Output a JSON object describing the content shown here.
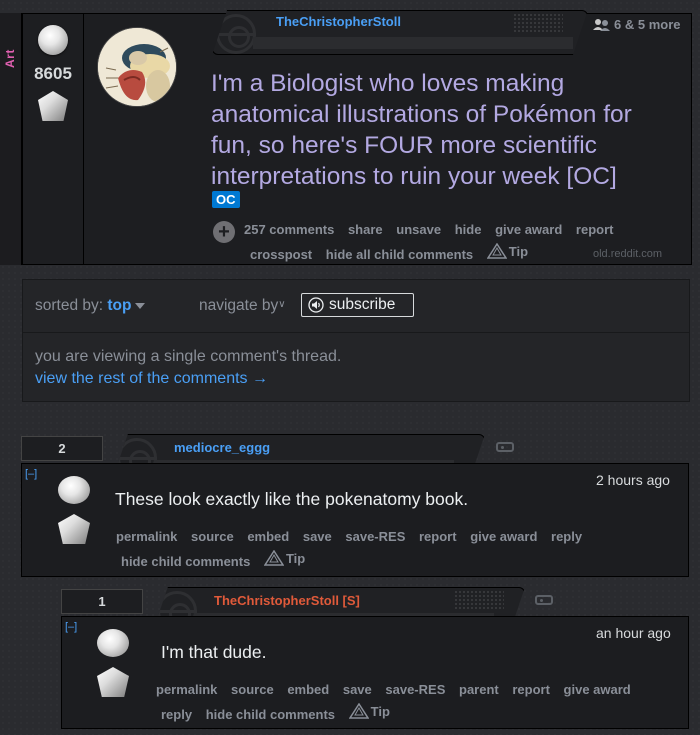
{
  "post": {
    "subreddit_tag": "Art",
    "score": "8605",
    "author": "TheChristopherStoll",
    "author_color": "#4a9ff5",
    "more_link": "& 5 more",
    "more_count": "6",
    "title": "I'm a Biologist who loves making anatomical illustrations of Pokémon for fun, so here's FOUR more scientific interpretations to ruin your week [OC]",
    "flair": "OC",
    "buttons_line1": [
      "257 comments",
      "share",
      "unsave",
      "hide",
      "give award",
      "report"
    ],
    "buttons_line2": [
      "crosspost",
      "hide all child comments"
    ],
    "tip_label": "Tip",
    "domain": "old.reddit.com"
  },
  "menu": {
    "sorted_label": "sorted by:",
    "sorted_value": "top",
    "navigate_label": "navigate by",
    "subscribe_label": "subscribe",
    "single_thread_note": "you are viewing a single comment's thread.",
    "rest_link": "view the rest of the comments →"
  },
  "comments": [
    {
      "score": "2",
      "author": "mediocre_eggg",
      "author_color": "#4a9ff5",
      "collapse": "[–]",
      "time": "2 hours ago",
      "text": "These look exactly like the pokenatomy book.",
      "buttons_line1": [
        "permalink",
        "source",
        "embed",
        "save",
        "save-RES",
        "report",
        "give award",
        "reply"
      ],
      "buttons_line2": [
        "hide child comments"
      ],
      "tip_label": "Tip"
    },
    {
      "score": "1",
      "author": "TheChristopherStoll [S]",
      "author_color": "#e05a3a",
      "collapse": "[–]",
      "time": "an hour ago",
      "text": "I'm that dude.",
      "buttons_line1": [
        "permalink",
        "source",
        "embed",
        "save",
        "save-RES",
        "parent",
        "report",
        "give award"
      ],
      "buttons_line2": [
        "reply",
        "hide child comments"
      ],
      "tip_label": "Tip"
    }
  ],
  "icons": {
    "expand": "plus-circle-icon",
    "upvote": "pokeball-upvote-icon",
    "downvote": "gem-downvote-icon",
    "tip": "triangle-tip-icon",
    "subscribe": "speaker-icon",
    "tag": "tag-icon"
  }
}
